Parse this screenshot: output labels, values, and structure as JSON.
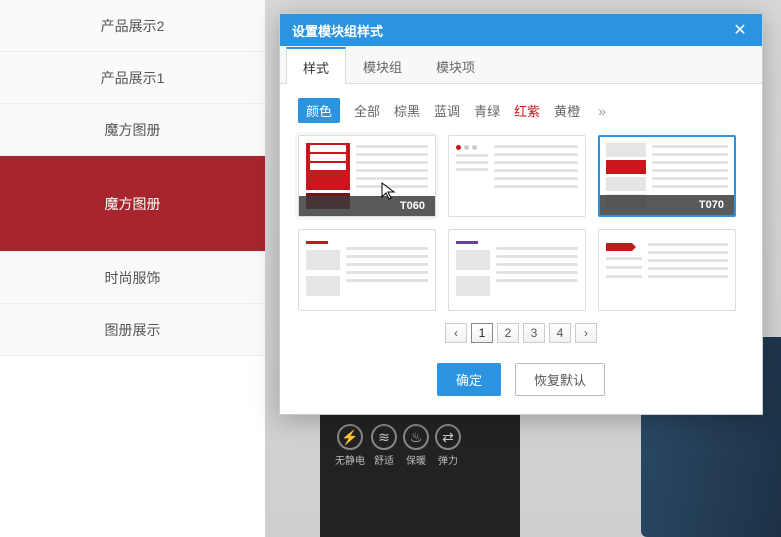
{
  "sidebar": {
    "items": [
      {
        "label": "产品展示2"
      },
      {
        "label": "产品展示1"
      },
      {
        "label": "魔方图册"
      },
      {
        "label": "魔方图册"
      },
      {
        "label": "时尚服饰"
      },
      {
        "label": "图册展示"
      }
    ],
    "activeIndex": 3
  },
  "badges": [
    {
      "label": "无静电",
      "glyph": "⚡"
    },
    {
      "label": "舒适",
      "glyph": "≋"
    },
    {
      "label": "保暖",
      "glyph": "♨"
    },
    {
      "label": "弹力",
      "glyph": "⇄"
    }
  ],
  "dialog": {
    "title": "设置模块组样式",
    "tabs": [
      {
        "label": "样式"
      },
      {
        "label": "模块组"
      },
      {
        "label": "模块项"
      }
    ],
    "activeTab": 0,
    "filters": [
      {
        "label": "颜色",
        "kind": "pill"
      },
      {
        "label": "全部",
        "kind": "normal"
      },
      {
        "label": "棕黑",
        "kind": "normal"
      },
      {
        "label": "蓝调",
        "kind": "normal"
      },
      {
        "label": "青绿",
        "kind": "normal"
      },
      {
        "label": "红紫",
        "kind": "selected"
      },
      {
        "label": "黄橙",
        "kind": "normal"
      }
    ],
    "templates": [
      {
        "id": "T060",
        "state": "hover"
      },
      {
        "id": "",
        "state": ""
      },
      {
        "id": "T070",
        "state": "selected"
      },
      {
        "id": "",
        "state": ""
      },
      {
        "id": "",
        "state": ""
      },
      {
        "id": "",
        "state": ""
      }
    ],
    "pager": {
      "pages": [
        "1",
        "2",
        "3",
        "4"
      ],
      "active": 0,
      "prev": "‹",
      "next": "›"
    },
    "buttons": {
      "ok": "确定",
      "reset": "恢复默认"
    }
  }
}
